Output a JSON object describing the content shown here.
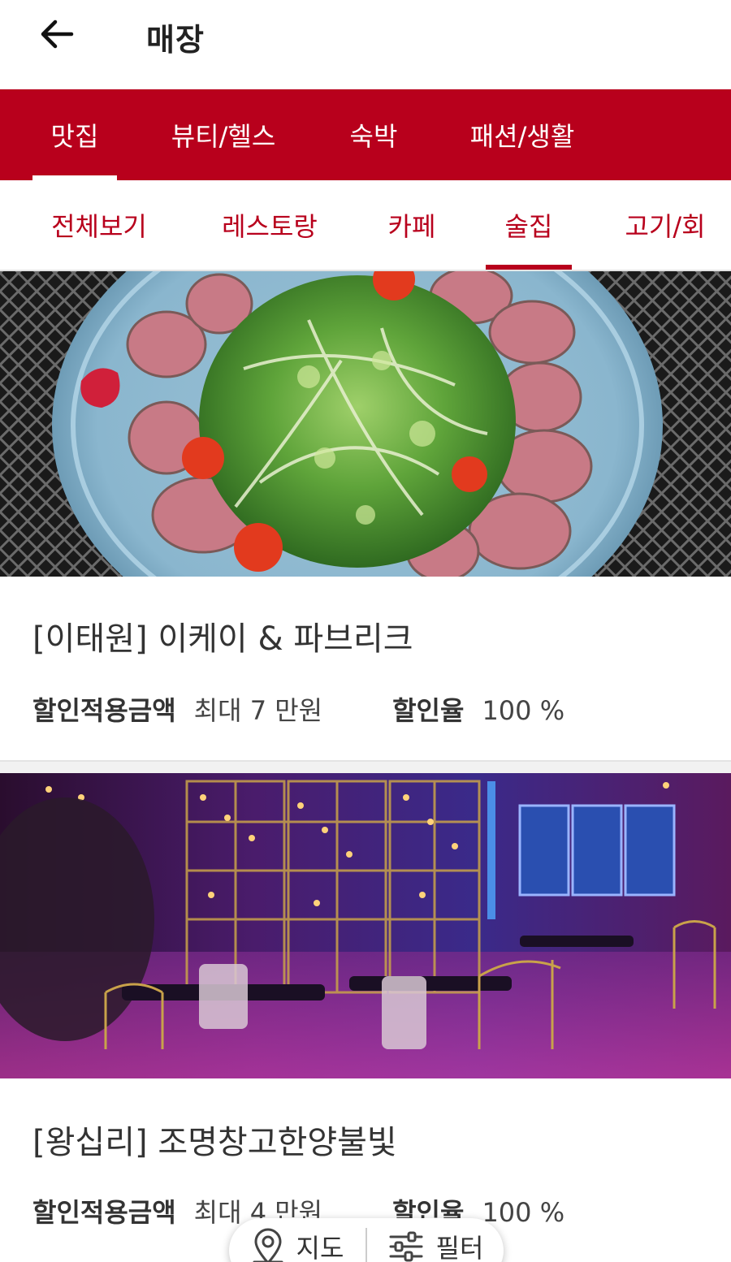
{
  "header": {
    "title": "매장",
    "back_icon": "arrow-left-icon"
  },
  "categories": [
    {
      "label": "맛집",
      "active": true
    },
    {
      "label": "뷰티/헬스",
      "active": false
    },
    {
      "label": "숙박",
      "active": false
    },
    {
      "label": "패션/생활",
      "active": false
    }
  ],
  "subcategories": [
    {
      "label": "전체보기",
      "active": false
    },
    {
      "label": "레스토랑",
      "active": false
    },
    {
      "label": "카페",
      "active": false
    },
    {
      "label": "술집",
      "active": true
    },
    {
      "label": "고기/회",
      "active": false
    }
  ],
  "stores": [
    {
      "name": "[이태원] 이케이 & 파브리크",
      "discount_amount_label": "할인적용금액",
      "discount_amount_value": "최대 7 만원",
      "discount_rate_label": "할인율",
      "discount_rate_value": "100 %"
    },
    {
      "name": "[왕십리] 조명창고한양불빛",
      "discount_amount_label": "할인적용금액",
      "discount_amount_value": "최대 4 만원",
      "discount_rate_label": "할인율",
      "discount_rate_value": "100 %"
    }
  ],
  "floating_bar": {
    "map_label": "지도",
    "map_icon": "map-pin-icon",
    "filter_label": "필터",
    "filter_icon": "sliders-icon"
  },
  "colors": {
    "accent": "#b8001c",
    "background": "#ffffff"
  }
}
